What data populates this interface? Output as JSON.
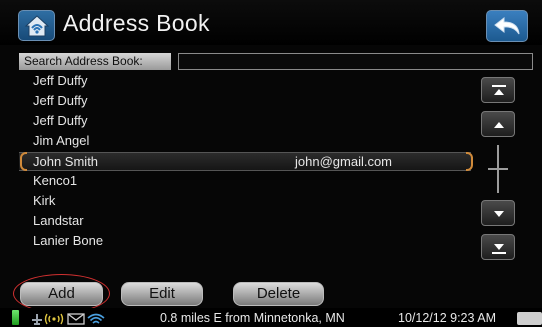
{
  "header": {
    "title": "Address Book",
    "home_icon": "home-icon",
    "back_icon": "back-arrow-icon"
  },
  "search": {
    "label": "Search Address Book:",
    "value": ""
  },
  "contacts": [
    {
      "name": "Jeff Duffy",
      "email": ""
    },
    {
      "name": "Jeff Duffy",
      "email": ""
    },
    {
      "name": "Jeff Duffy",
      "email": ""
    },
    {
      "name": "Jim Angel",
      "email": ""
    },
    {
      "name": "John Smith",
      "email": "john@gmail.com",
      "selected": true
    },
    {
      "name": "Kenco1",
      "email": ""
    },
    {
      "name": "Kirk",
      "email": ""
    },
    {
      "name": "Landstar",
      "email": ""
    },
    {
      "name": "Lanier Bone",
      "email": ""
    }
  ],
  "scroll": {
    "top_icon": "scroll-to-top-icon",
    "up_icon": "scroll-up-icon",
    "down_icon": "scroll-down-icon",
    "bottom_icon": "scroll-to-bottom-icon"
  },
  "actions": {
    "add_label": "Add",
    "edit_label": "Edit",
    "delete_label": "Delete"
  },
  "status_bar": {
    "location": "0.8 miles E from Minnetonka, MN",
    "datetime": "10/12/12 9:23 AM"
  },
  "colors": {
    "accent_blue": "#2f6ea3",
    "selection_bracket": "#d08a3a",
    "highlight_ring": "#d03030"
  }
}
